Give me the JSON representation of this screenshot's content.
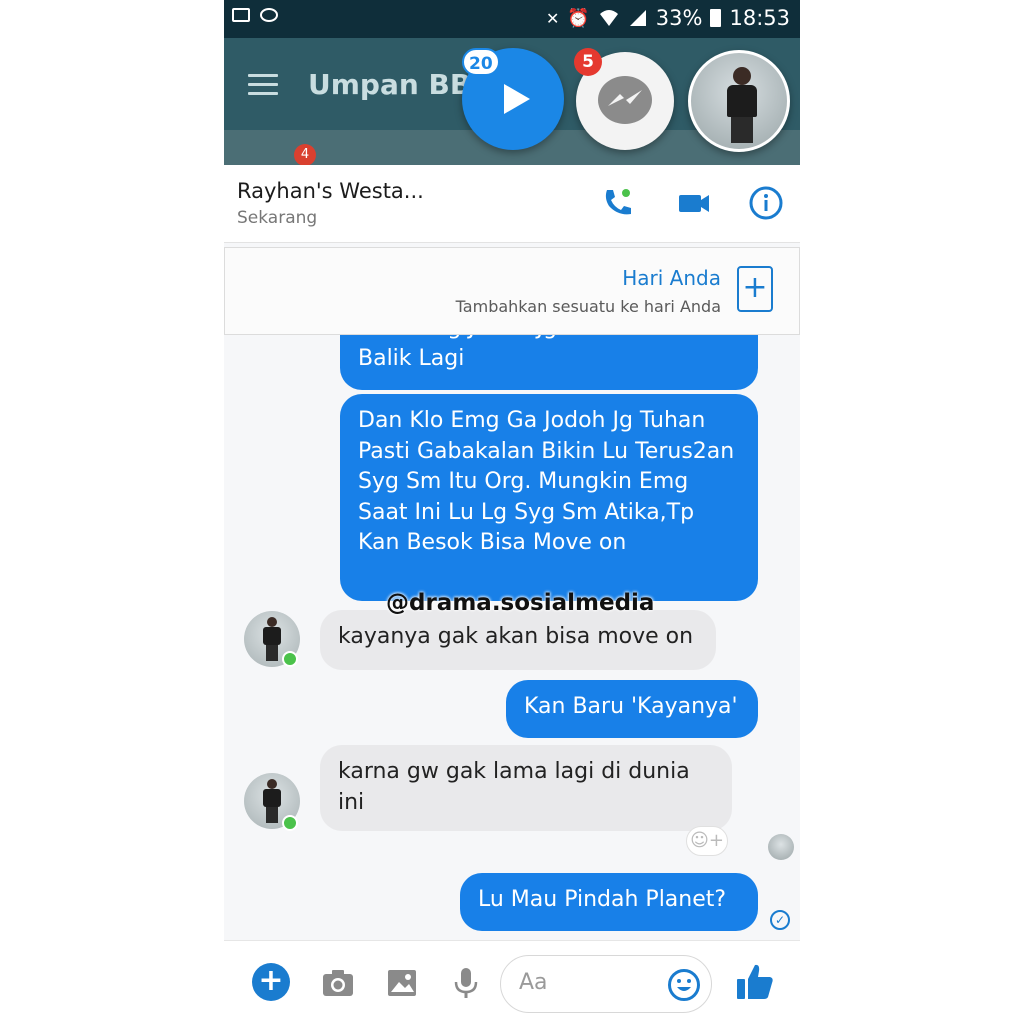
{
  "status_bar": {
    "battery": "33%",
    "time": "18:53"
  },
  "bbm": {
    "title": "Umpan BBM",
    "tab_badge": "4"
  },
  "chat_heads": {
    "play_badge": "20",
    "messenger_badge": "5"
  },
  "conversation": {
    "name": "Rayhan's Westa...",
    "subtitle": "Sekarang"
  },
  "day_banner": {
    "title": "Hari Anda",
    "subtitle": "Tambahkan sesuatu ke hari Anda",
    "add_symbol": "+"
  },
  "messages": [
    {
      "dir": "out",
      "text": "Kalo Emg Jodoh Jg Pasti Bakal Balik Lagi"
    },
    {
      "dir": "out",
      "text": "Dan Klo Emg Ga Jodoh Jg Tuhan Pasti Gabakalan Bikin Lu Terus2an Syg Sm Itu Org. Mungkin Emg Saat Ini Lu Lg Syg Sm Atika,Tp Kan Besok Bisa Move on"
    },
    {
      "dir": "in",
      "text": "kayanya gak akan bisa move on"
    },
    {
      "dir": "out",
      "text": "Kan Baru 'Kayanya'"
    },
    {
      "dir": "in",
      "text": "karna gw gak lama lagi di dunia ini"
    },
    {
      "dir": "out",
      "text": "Lu Mau Pindah Planet?"
    }
  ],
  "watermark": "@drama.sosialmedia",
  "composer": {
    "placeholder": "Aa",
    "plus_symbol": "+"
  },
  "colors": {
    "accent": "#1880e8",
    "incoming": "#e9e9eb",
    "online": "#4bc24b",
    "bbm_header": "#2f5b66"
  }
}
